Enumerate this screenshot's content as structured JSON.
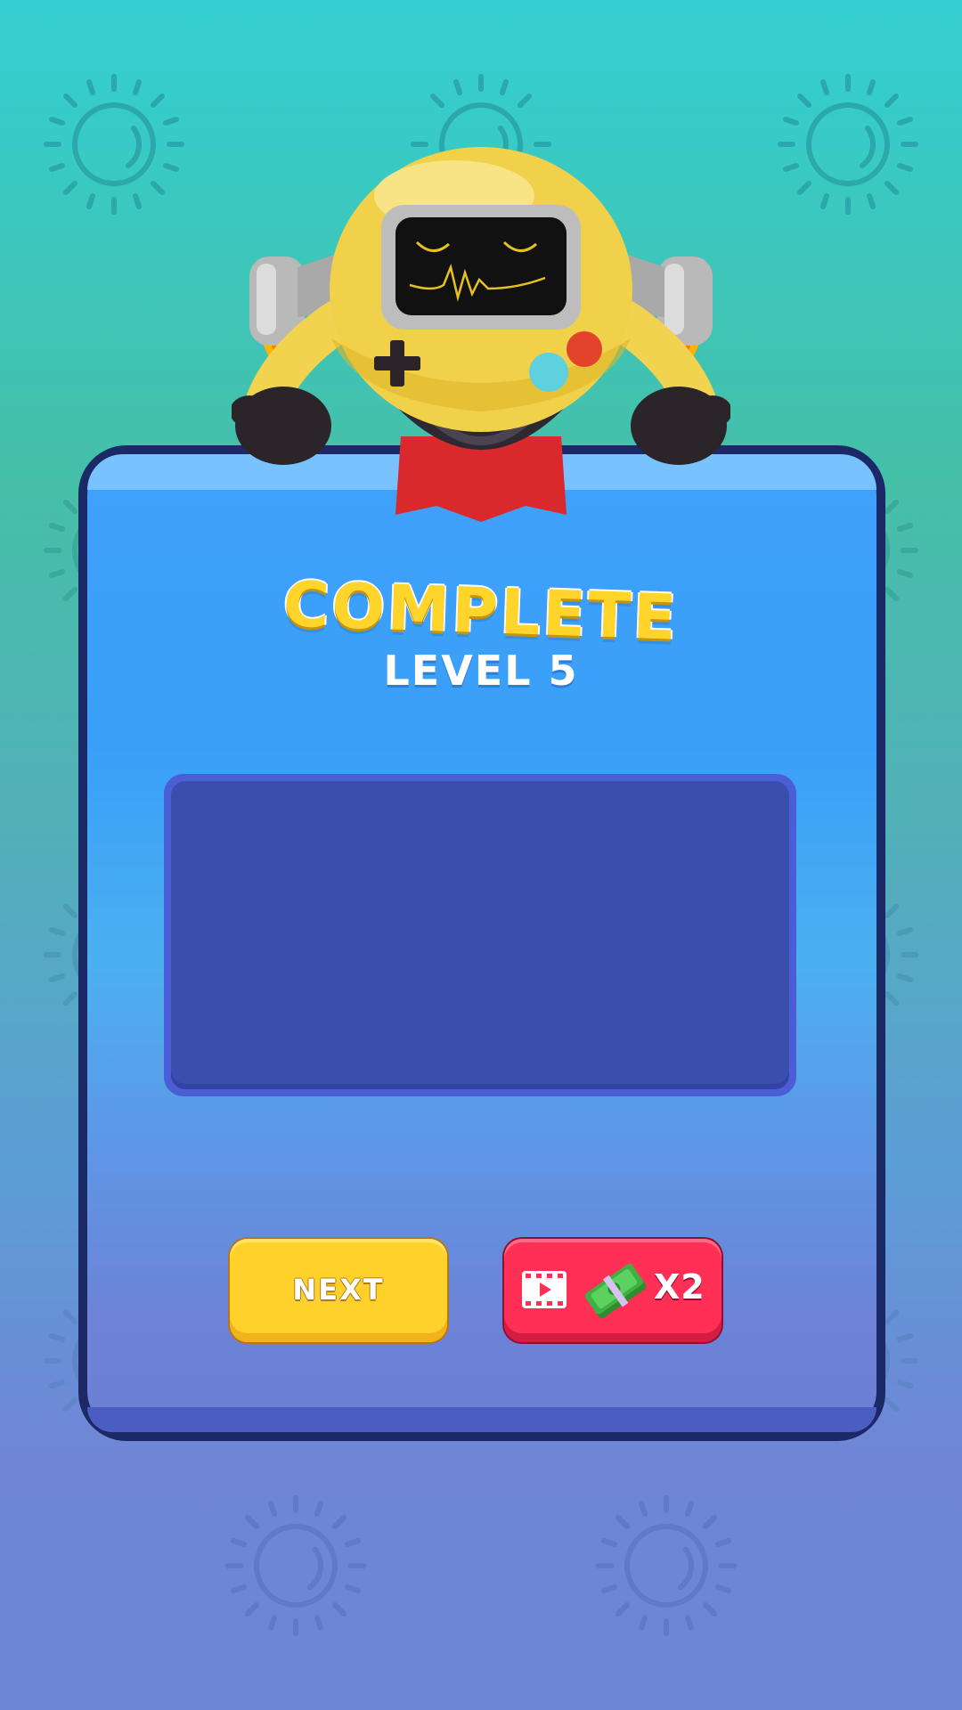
{
  "screen": {
    "title": "COMPLETE",
    "subtitle": "LEVEL 5"
  },
  "buttons": {
    "next_label": "NEXT",
    "reward_label": "X2"
  },
  "icons": {
    "background": "sun-icon",
    "reward_video": "video-play-icon",
    "reward_cash": "cash-stack-icon",
    "mascot": "robot-mascot"
  },
  "colors": {
    "title": "#ffd52b",
    "next_button": "#ffd12a",
    "reward_button": "#ff2f56",
    "panel": "#3a4eae",
    "card_border": "#1b2a67"
  }
}
